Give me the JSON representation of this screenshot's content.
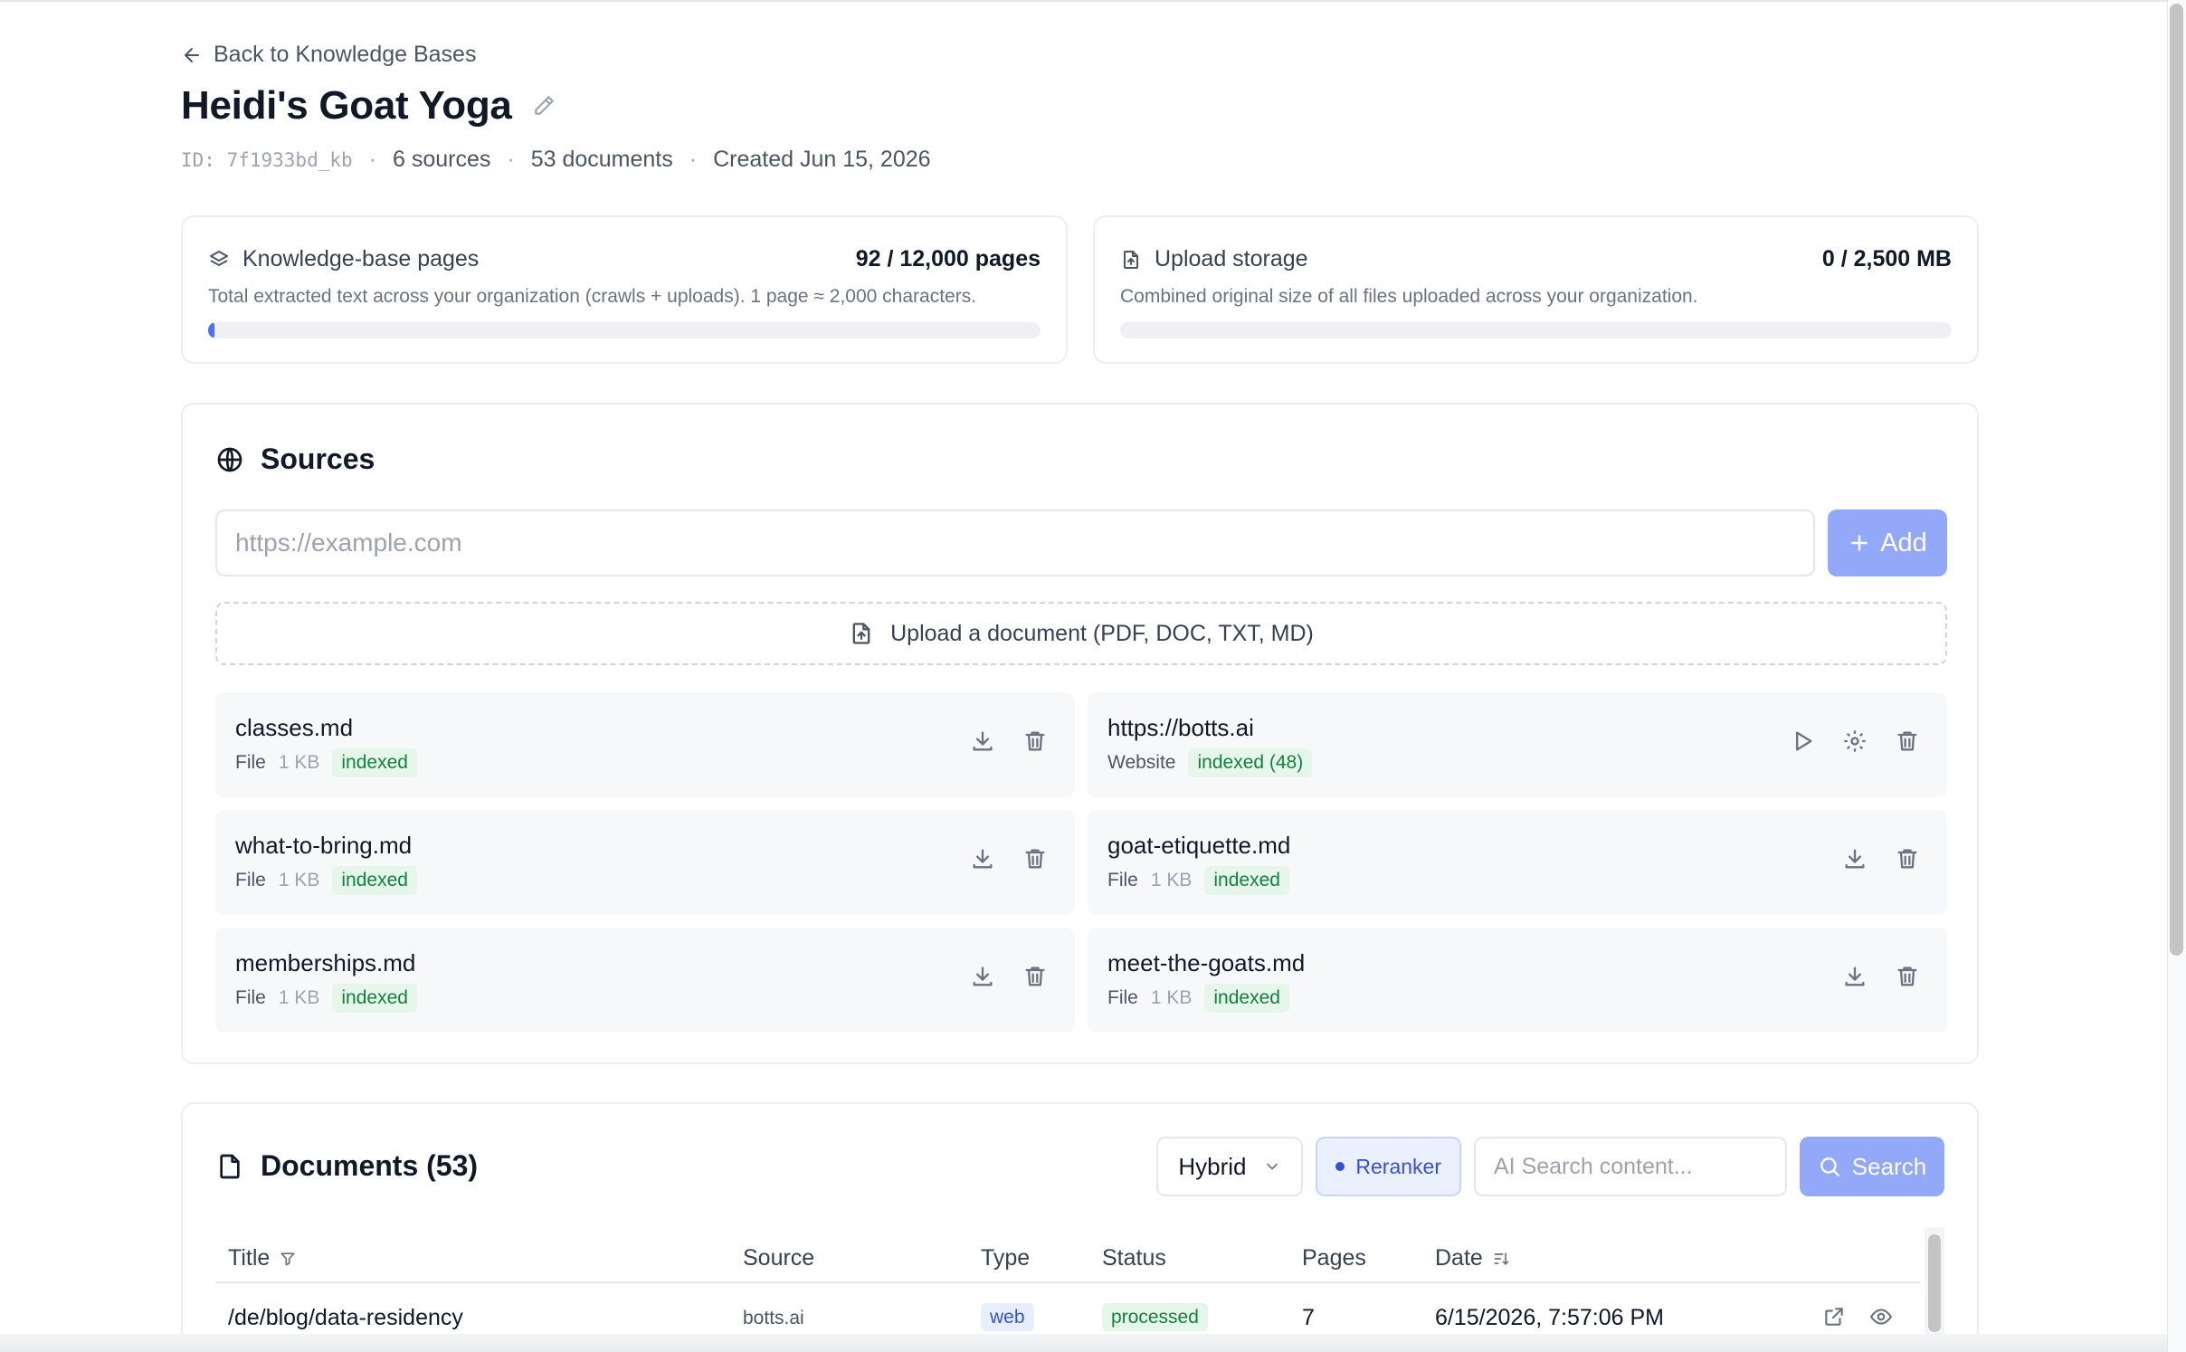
{
  "header": {
    "back_label": "Back to Knowledge Bases",
    "title": "Heidi's Goat Yoga",
    "id_label": "ID: 7f1933bd_kb",
    "sources_count": "6 sources",
    "documents_count": "53 documents",
    "created": "Created Jun 15, 2026",
    "separator": "·"
  },
  "usage": {
    "pages": {
      "label": "Knowledge-base pages",
      "value": "92 / 12,000 pages",
      "description": "Total extracted text across your organization (crawls + uploads). 1 page ≈ 2,000 characters.",
      "fraction": 0.0077
    },
    "storage": {
      "label": "Upload storage",
      "value": "0 / 2,500 MB",
      "description": "Combined original size of all files uploaded across your organization.",
      "fraction": 0
    }
  },
  "sources": {
    "title": "Sources",
    "url_placeholder": "https://example.com",
    "add_label": "Add",
    "upload_label": "Upload a document (PDF, DOC, TXT, MD)",
    "items": [
      {
        "name": "classes.md",
        "kind": "File",
        "size": "1 KB",
        "status": "indexed",
        "actions": [
          "download-icon",
          "trash-icon"
        ]
      },
      {
        "name": "https://botts.ai",
        "kind": "Website",
        "size": "",
        "status": "indexed (48)",
        "actions": [
          "play-icon",
          "gear-icon",
          "trash-icon"
        ]
      },
      {
        "name": "what-to-bring.md",
        "kind": "File",
        "size": "1 KB",
        "status": "indexed",
        "actions": [
          "download-icon",
          "trash-icon"
        ]
      },
      {
        "name": "goat-etiquette.md",
        "kind": "File",
        "size": "1 KB",
        "status": "indexed",
        "actions": [
          "download-icon",
          "trash-icon"
        ]
      },
      {
        "name": "memberships.md",
        "kind": "File",
        "size": "1 KB",
        "status": "indexed",
        "actions": [
          "download-icon",
          "trash-icon"
        ]
      },
      {
        "name": "meet-the-goats.md",
        "kind": "File",
        "size": "1 KB",
        "status": "indexed",
        "actions": [
          "download-icon",
          "trash-icon"
        ]
      }
    ]
  },
  "documents": {
    "title": "Documents (53)",
    "mode": "Hybrid",
    "reranker_label": "Reranker",
    "search_placeholder": "AI Search content...",
    "search_label": "Search",
    "columns": {
      "title": "Title",
      "source": "Source",
      "type": "Type",
      "status": "Status",
      "pages": "Pages",
      "date": "Date"
    },
    "rows": [
      {
        "title": "/de/blog/data-residency",
        "source": "botts.ai",
        "type": "web",
        "status": "processed",
        "pages": "7",
        "date": "6/15/2026, 7:57:06 PM"
      }
    ]
  },
  "colors": {
    "accent": "#4f6ef7",
    "accent_disabled": "#93a8f8",
    "indexed_green": "#15803d",
    "web_blue": "#3651d4"
  }
}
